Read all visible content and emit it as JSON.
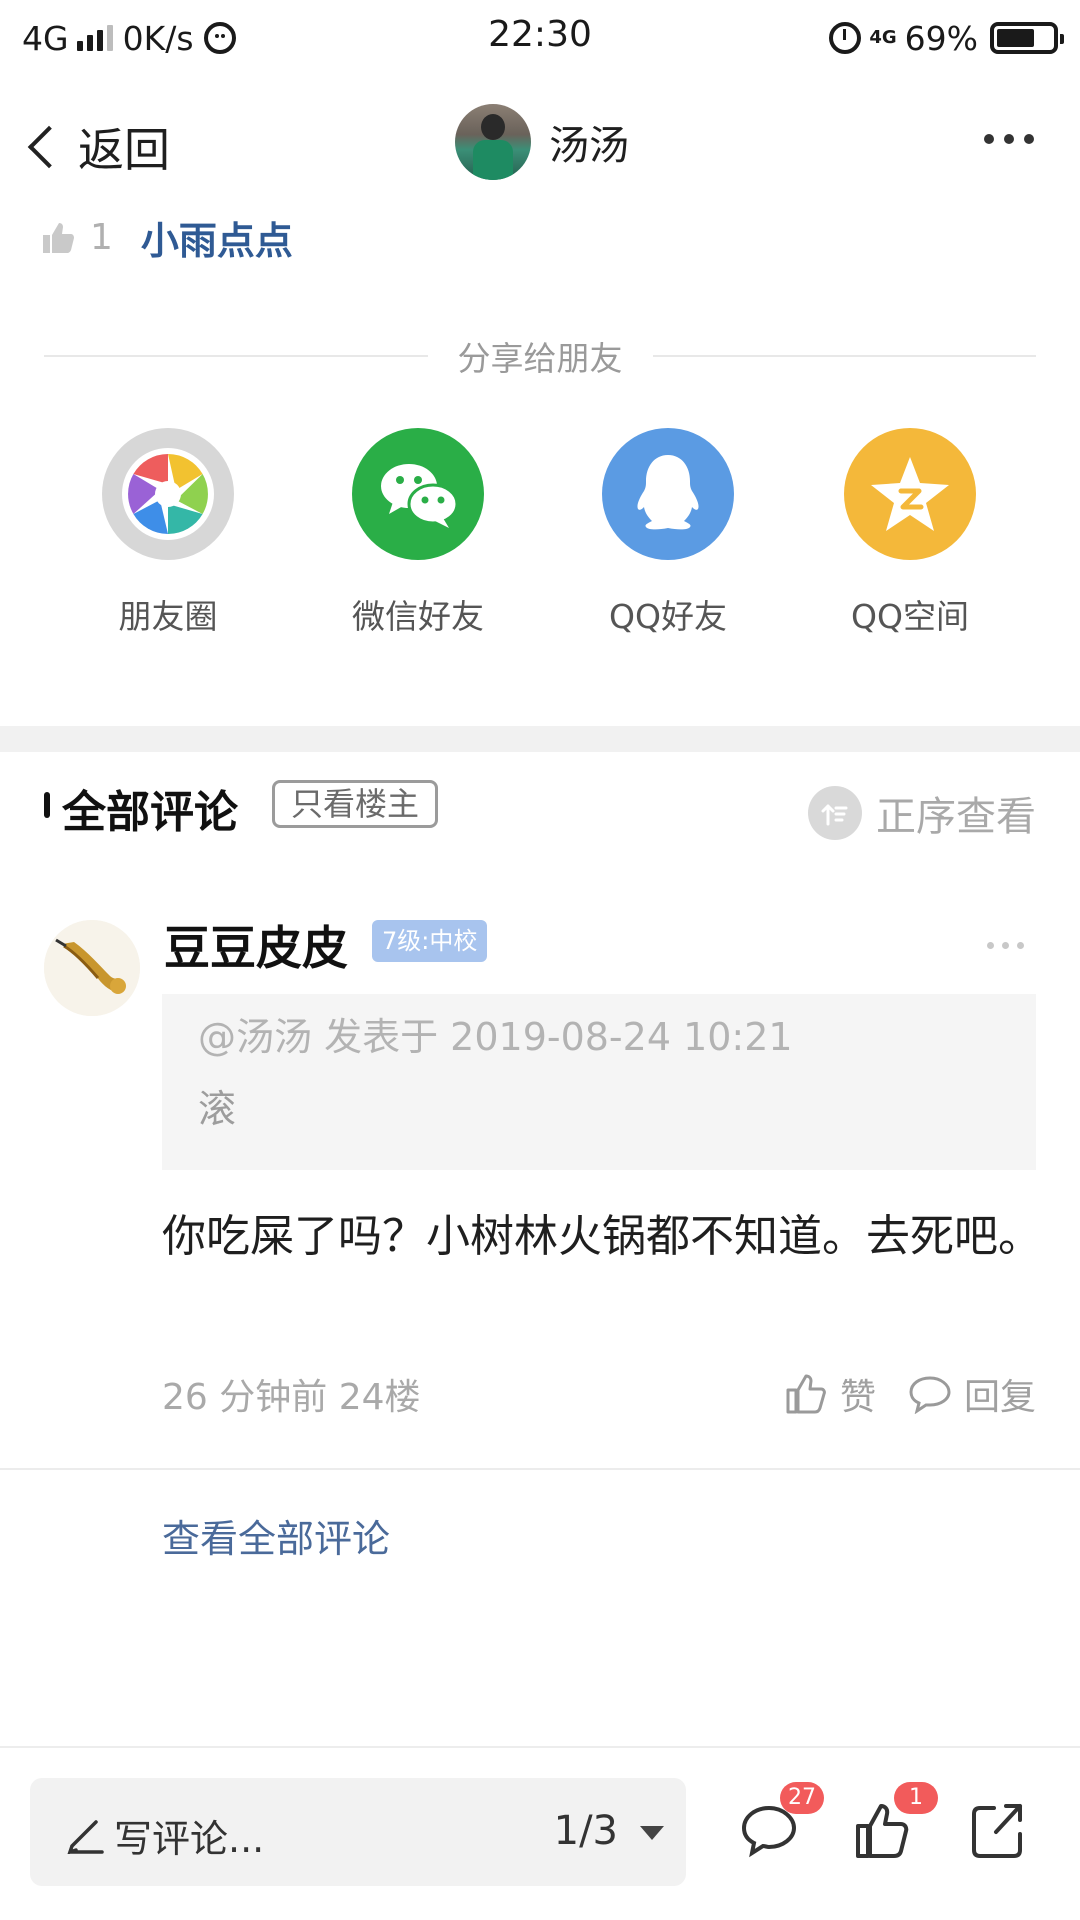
{
  "status_bar": {
    "network": "4G",
    "speed": "0K/s",
    "time": "22:30",
    "net_small": "4G",
    "battery": "69%",
    "battery_level": 0.69
  },
  "nav": {
    "back_label": "返回",
    "title": "汤汤"
  },
  "likes": {
    "count": "1",
    "user": "小雨点点"
  },
  "share": {
    "title": "分享给朋友",
    "items": [
      {
        "label": "朋友圈",
        "icon": "moments-icon"
      },
      {
        "label": "微信好友",
        "icon": "wechat-icon"
      },
      {
        "label": "QQ好友",
        "icon": "qq-icon"
      },
      {
        "label": "QQ空间",
        "icon": "qzone-icon"
      }
    ]
  },
  "comments": {
    "title": "全部评论",
    "only_op": "只看楼主",
    "sort_label": "正序查看",
    "items": [
      {
        "user": "豆豆皮皮",
        "level": "7级:中校",
        "quote_meta": "@汤汤 发表于 2019-08-24 10:21",
        "quote_text": "滚",
        "body": "你吃屎了吗？小树林火锅都不知道。去死吧。",
        "meta": "26 分钟前  24楼",
        "like_label": "赞",
        "reply_label": "回复"
      }
    ],
    "see_all": "查看全部评论"
  },
  "bottom_bar": {
    "write_placeholder": "写评论...",
    "page_indicator": "1/3",
    "comment_badge": "27",
    "like_badge": "1"
  },
  "colors": {
    "link": "#2f5a94",
    "wechat": "#2aae47",
    "qq": "#5b9be3",
    "qzone": "#f4b83a",
    "badge": "#f25b5b",
    "level_badge": "#a8c4ee"
  }
}
